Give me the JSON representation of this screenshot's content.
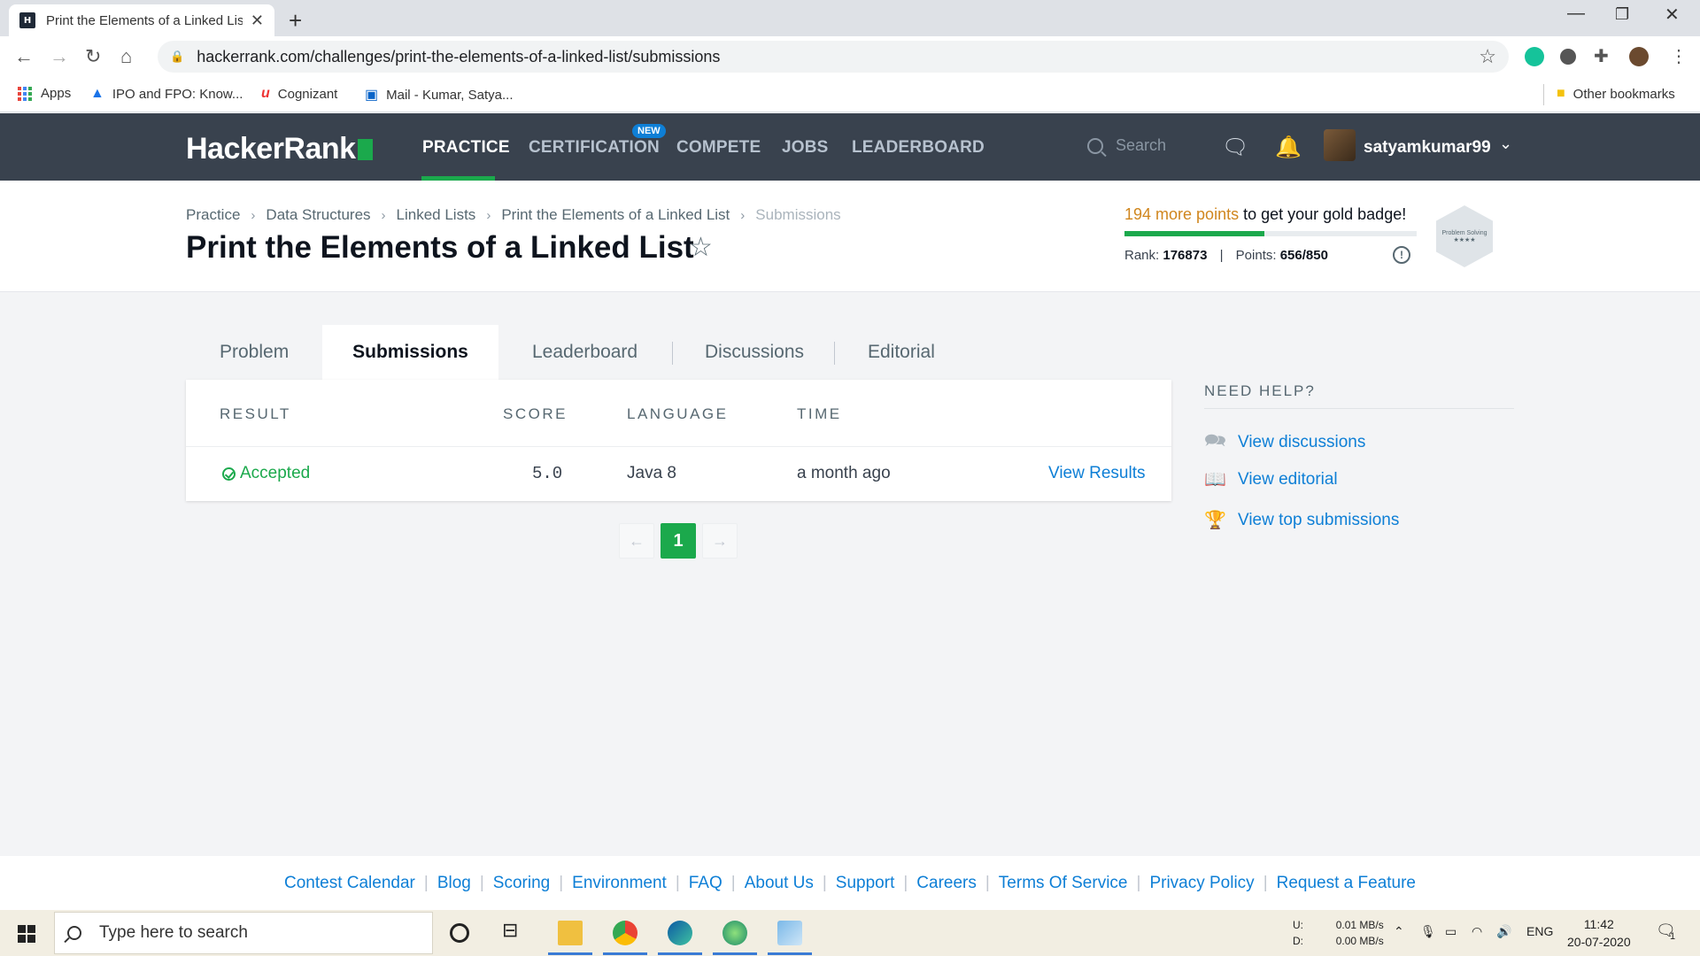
{
  "browser": {
    "tab_title": "Print the Elements of a Linked List",
    "favicon": "H",
    "url": "hackerrank.com/challenges/print-the-elements-of-a-linked-list/submissions",
    "bookmarks": [
      {
        "label": "Apps",
        "icon": "apps-grid-icon"
      },
      {
        "label": "IPO and FPO: Know...",
        "icon": "drive-icon"
      },
      {
        "label": "Cognizant",
        "icon": "cognizant-icon"
      },
      {
        "label": "Mail - Kumar, Satya...",
        "icon": "outlook-icon"
      }
    ],
    "other_bookmarks": "Other bookmarks"
  },
  "header": {
    "logo": "HackerRank",
    "nav": [
      "PRACTICE",
      "CERTIFICATION",
      "COMPETE",
      "JOBS",
      "LEADERBOARD"
    ],
    "new_badge": "NEW",
    "search_placeholder": "Search",
    "username": "satyamkumar99"
  },
  "breadcrumb": [
    "Practice",
    "Data Structures",
    "Linked Lists",
    "Print the Elements of a Linked List",
    "Submissions"
  ],
  "page_title": "Print the Elements of a Linked List",
  "badge_progress": {
    "points_text": "194 more points",
    "suffix": " to get your gold badge!",
    "fraction": 0.48,
    "rank_label": "Rank:",
    "rank": "176873",
    "points_label": "Points:",
    "points": "656/850",
    "badge_caption": "Problem Solving",
    "badge_stars": "★★★★"
  },
  "tabs": [
    "Problem",
    "Submissions",
    "Leaderboard",
    "Discussions",
    "Editorial"
  ],
  "table": {
    "headers": [
      "RESULT",
      "SCORE",
      "LANGUAGE",
      "TIME"
    ],
    "rows": [
      {
        "result": "Accepted",
        "score": "5.0",
        "language": "Java 8",
        "time": "a month ago",
        "action": "View Results"
      }
    ]
  },
  "pagination": {
    "prev": "←",
    "current": "1",
    "next": "→"
  },
  "need_help": {
    "title": "NEED HELP?",
    "items": [
      "View discussions",
      "View editorial",
      "View top submissions"
    ]
  },
  "footer": [
    "Contest Calendar",
    "Blog",
    "Scoring",
    "Environment",
    "FAQ",
    "About Us",
    "Support",
    "Careers",
    "Terms Of Service",
    "Privacy Policy",
    "Request a Feature"
  ],
  "taskbar": {
    "search_placeholder": "Type here to search",
    "net_up_label": "U:",
    "net_up": "0.01 MB/s",
    "net_down_label": "D:",
    "net_down": "0.00 MB/s",
    "lang": "ENG",
    "time": "11:42",
    "date": "20-07-2020",
    "notif_count": "1"
  },
  "colors": {
    "brand_green": "#1ba94c",
    "header_bg": "#39424e",
    "link_blue": "#0e7fd6",
    "points_orange": "#d0861e"
  }
}
